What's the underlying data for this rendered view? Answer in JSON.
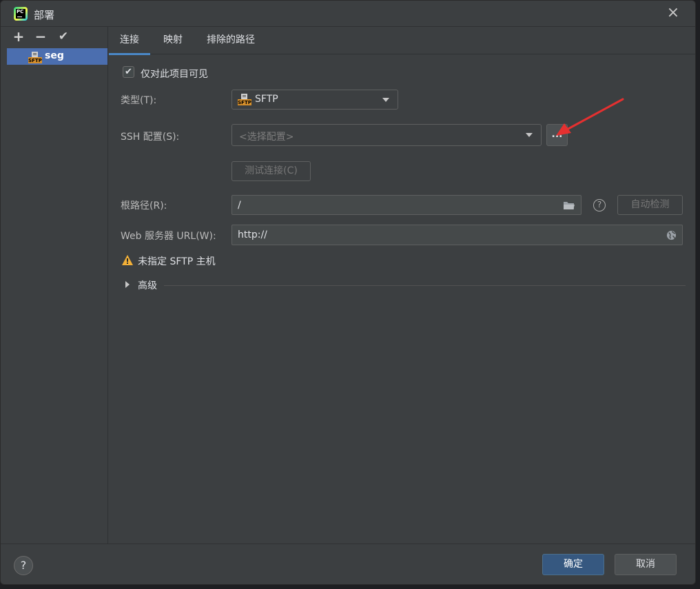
{
  "window": {
    "title": "部署"
  },
  "app_icon": {
    "text": "PC"
  },
  "sidebar": {
    "toolbar": {
      "add": "+",
      "remove": "−",
      "apply": "✔"
    },
    "servers": [
      {
        "label": "seg",
        "type_badge": "SFTP"
      }
    ]
  },
  "tabs": [
    {
      "label": "连接",
      "active": true
    },
    {
      "label": "映射",
      "active": false
    },
    {
      "label": "排除的路径",
      "active": false
    }
  ],
  "connection": {
    "visible_only_label": "仅对此项目可见",
    "visible_only_checked": true,
    "type_label": "类型(T):",
    "type_value": "SFTP",
    "ssh_label": "SSH 配置(S):",
    "ssh_placeholder": "<选择配置>",
    "ssh_more_button": "...",
    "test_button": "测试连接(C)",
    "root_label": "根路径(R):",
    "root_value": "/",
    "auto_detect_button": "自动检测",
    "web_url_label": "Web 服务器 URL(W):",
    "web_url_value": "http://",
    "warning_text": "未指定 SFTP 主机",
    "advanced_label": "高级"
  },
  "footer": {
    "help": "?",
    "ok_button": "确定",
    "cancel_button": "取消"
  },
  "colors": {
    "accent": "#4a88c7",
    "selected_item": "#4b6eaf",
    "ok_button": "#365880",
    "warning": "#f2b038",
    "annotation": "#e53030"
  }
}
